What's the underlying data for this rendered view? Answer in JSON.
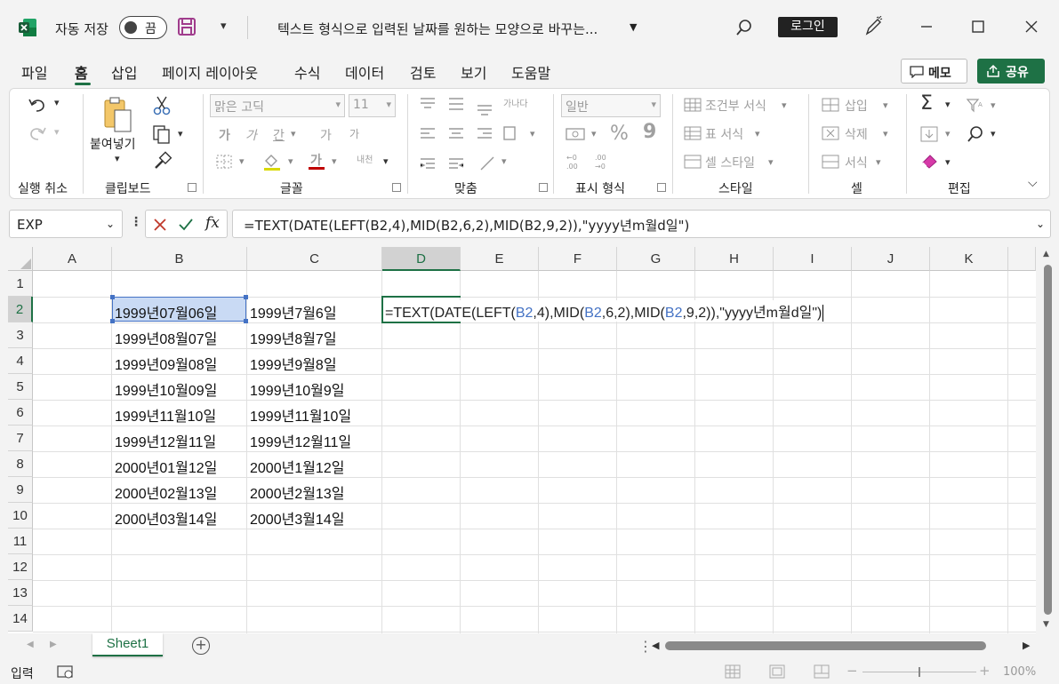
{
  "titlebar": {
    "autosave_label": "자동 저장",
    "autosave_state": "끔",
    "document_title": "텍스트 형식으로 입력된 날짜를 원하는 모양으로 바꾸는...",
    "login_label": "로그인"
  },
  "tabs": [
    "파일",
    "홈",
    "삽입",
    "페이지 레이아웃",
    "수식",
    "데이터",
    "검토",
    "보기",
    "도움말"
  ],
  "active_tab": "홈",
  "memo_label": "메모",
  "share_label": "공유",
  "ribbon": {
    "groups": {
      "undo": "실행 취소",
      "clipboard": "클립보드",
      "font": "글꼴",
      "align": "맞춤",
      "number": "표시 형식",
      "styles": "스타일",
      "cells": "셀",
      "editing": "편집"
    },
    "paste_label": "붙여넣기",
    "font_name": "맑은 고딕",
    "font_size": "11",
    "font_grow": "가",
    "font_shrink": "가",
    "bold": "가",
    "italic": "가",
    "underline": "간",
    "strike": "가",
    "font_color_letter": "가",
    "phonetic_label": "내천",
    "wrap_label": "가나다",
    "number_format": "일반",
    "percent": "%",
    "comma": "9",
    "conditional_format": "조건부 서식",
    "table_format": "표 서식",
    "cell_styles": "셀 스타일",
    "insert": "삽입",
    "delete": "삭제",
    "format": "서식"
  },
  "formula_bar": {
    "name_box": "EXP",
    "formula": "=TEXT(DATE(LEFT(B2,4),MID(B2,6,2),MID(B2,9,2)),\"yyyy년m월d일\")"
  },
  "editing_formula": {
    "p1": "=TEXT(DATE(LEFT(",
    "r1": "B2",
    "p2": ",4),MID(",
    "r2": "B2",
    "p3": ",6,2),MID(",
    "r3": "B2",
    "p4": ",9,2)),\"yyyy년m월d일\")"
  },
  "columns": [
    "A",
    "B",
    "C",
    "D",
    "E",
    "F",
    "G",
    "H",
    "I",
    "J",
    "K"
  ],
  "rows": [
    "1",
    "2",
    "3",
    "4",
    "5",
    "6",
    "7",
    "8",
    "9",
    "10",
    "11",
    "12",
    "13",
    "14"
  ],
  "column_b": [
    "1999년07월06일",
    "1999년08월07일",
    "1999년09월08일",
    "1999년10월09일",
    "1999년11월10일",
    "1999년12월11일",
    "2000년01월12일",
    "2000년02월13일",
    "2000년03월14일"
  ],
  "column_c": [
    "1999년7월6일",
    "1999년8월7일",
    "1999년9월8일",
    "1999년10월9일",
    "1999년11월10일",
    "1999년12월11일",
    "2000년1월12일",
    "2000년2월13일",
    "2000년3월14일"
  ],
  "sheet_name": "Sheet1",
  "status": {
    "mode": "입력",
    "zoom": "100%"
  },
  "colors": {
    "excel_green": "#1e7145",
    "selection_fill": "#c9daf4",
    "reference_blue": "#4472c4"
  }
}
